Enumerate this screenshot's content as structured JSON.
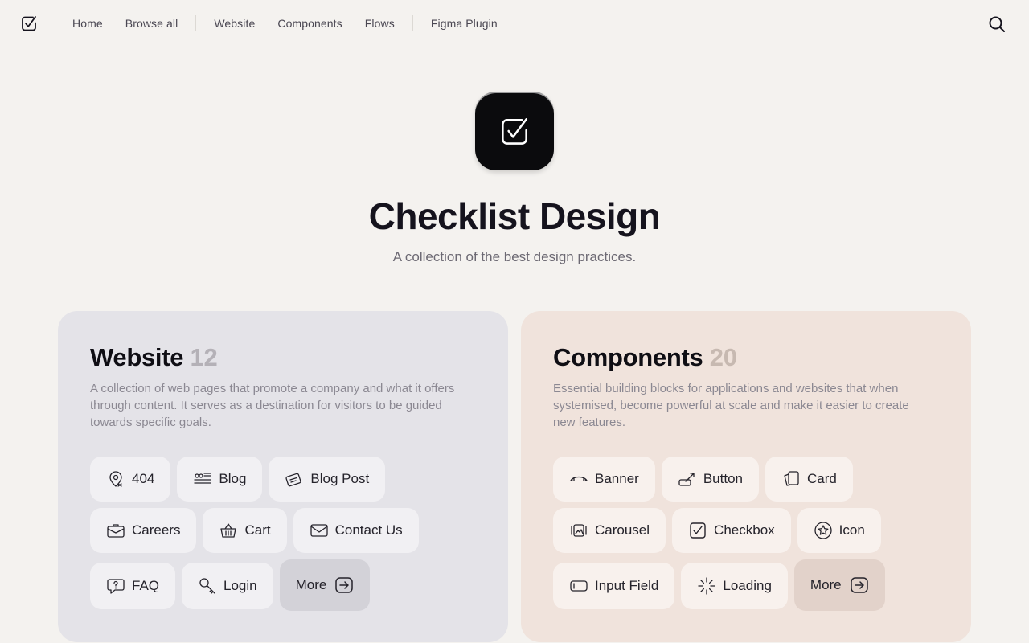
{
  "nav": {
    "items": [
      "Home",
      "Browse all",
      "Website",
      "Components",
      "Flows",
      "Figma Plugin"
    ]
  },
  "hero": {
    "title": "Checklist Design",
    "subtitle": "A collection of the best design practices."
  },
  "website": {
    "title": "Website",
    "count": "12",
    "description": "A collection of web pages that promote a company and what it offers through content. It serves as a destination for visitors to be guided towards specific goals.",
    "chips": [
      {
        "label": "404",
        "icon": "location-pin-icon"
      },
      {
        "label": "Blog",
        "icon": "blog-lines-icon"
      },
      {
        "label": "Blog Post",
        "icon": "blog-post-card-icon"
      },
      {
        "label": "Careers",
        "icon": "briefcase-icon"
      },
      {
        "label": "Cart",
        "icon": "basket-icon"
      },
      {
        "label": "Contact Us",
        "icon": "envelope-icon"
      },
      {
        "label": "FAQ",
        "icon": "question-bubble-icon"
      },
      {
        "label": "Login",
        "icon": "key-icon"
      }
    ],
    "more_label": "More"
  },
  "components": {
    "title": "Components",
    "count": "20",
    "description": "Essential building blocks for applications and websites that when systemised, become powerful at scale and make it easier to create new features.",
    "chips": [
      {
        "label": "Banner",
        "icon": "banner-icon"
      },
      {
        "label": "Button",
        "icon": "button-cursor-icon"
      },
      {
        "label": "Card",
        "icon": "cards-icon"
      },
      {
        "label": "Carousel",
        "icon": "carousel-icon"
      },
      {
        "label": "Checkbox",
        "icon": "checkbox-icon"
      },
      {
        "label": "Icon",
        "icon": "star-circle-icon"
      },
      {
        "label": "Input Field",
        "icon": "input-field-icon"
      },
      {
        "label": "Loading",
        "icon": "loading-spinner-icon"
      }
    ],
    "more_label": "More"
  }
}
